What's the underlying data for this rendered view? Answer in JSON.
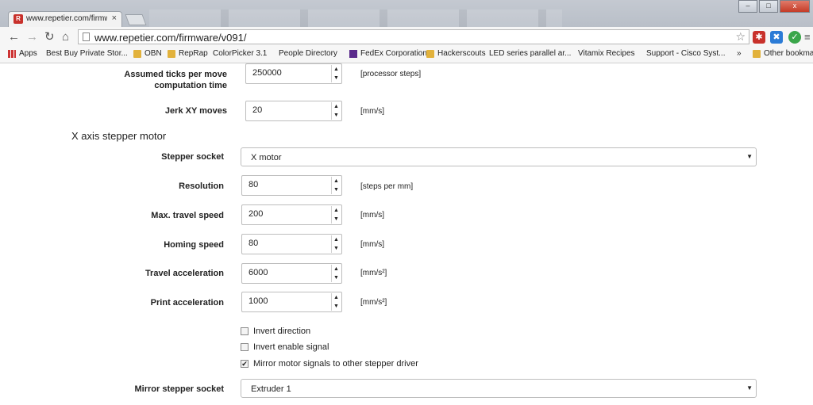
{
  "browser": {
    "tab_title": "www.repetier.com/firmwa",
    "tab_close": "×",
    "url": "www.repetier.com/firmware/v091/",
    "window_buttons": {
      "minimize": "–",
      "maximize": "□",
      "close": "x"
    },
    "bookmarks": [
      {
        "label": "Apps",
        "icon": "grid-icon"
      },
      {
        "label": "Best Buy Private Stor...",
        "icon": "page-icon"
      },
      {
        "label": "OBN",
        "icon": "folder-icon"
      },
      {
        "label": "RepRap",
        "icon": "folder-icon"
      },
      {
        "label": "ColorPicker 3.1",
        "icon": "page-icon"
      },
      {
        "label": "People Directory",
        "icon": "page-icon"
      },
      {
        "label": "FedEx Corporation",
        "icon": "fedex-icon"
      },
      {
        "label": "Hackerscouts",
        "icon": "folder-icon"
      },
      {
        "label": "LED series parallel ar...",
        "icon": "page-icon"
      },
      {
        "label": "Vitamix Recipes",
        "icon": "page-icon"
      },
      {
        "label": "Support - Cisco Syst...",
        "icon": "page-icon"
      },
      {
        "label": "»",
        "icon": ""
      },
      {
        "label": "Other bookmar",
        "icon": "folder-icon"
      }
    ]
  },
  "form": {
    "ticks": {
      "label_line1": "Assumed ticks per move",
      "label_line2": "computation time",
      "value": "250000",
      "unit": "[processor steps]"
    },
    "jerk": {
      "label": "Jerk XY moves",
      "value": "20",
      "unit": "[mm/s]"
    },
    "section_title": "X axis stepper motor",
    "stepper_socket": {
      "label": "Stepper socket",
      "value": "X motor"
    },
    "resolution": {
      "label": "Resolution",
      "value": "80",
      "unit": "[steps per mm]"
    },
    "max_travel": {
      "label": "Max. travel speed",
      "value": "200",
      "unit": "[mm/s]"
    },
    "homing": {
      "label": "Homing speed",
      "value": "80",
      "unit": "[mm/s]"
    },
    "travel_accel": {
      "label": "Travel acceleration",
      "value": "6000",
      "unit": "[mm/s²]"
    },
    "print_accel": {
      "label": "Print acceleration",
      "value": "1000",
      "unit": "[mm/s²]"
    },
    "checkboxes": [
      {
        "label": "Invert direction",
        "checked": false
      },
      {
        "label": "Invert enable signal",
        "checked": false
      },
      {
        "label": "Mirror motor signals to other stepper driver",
        "checked": true
      }
    ],
    "mirror_socket": {
      "label": "Mirror stepper socket",
      "value": "Extruder 1"
    }
  }
}
